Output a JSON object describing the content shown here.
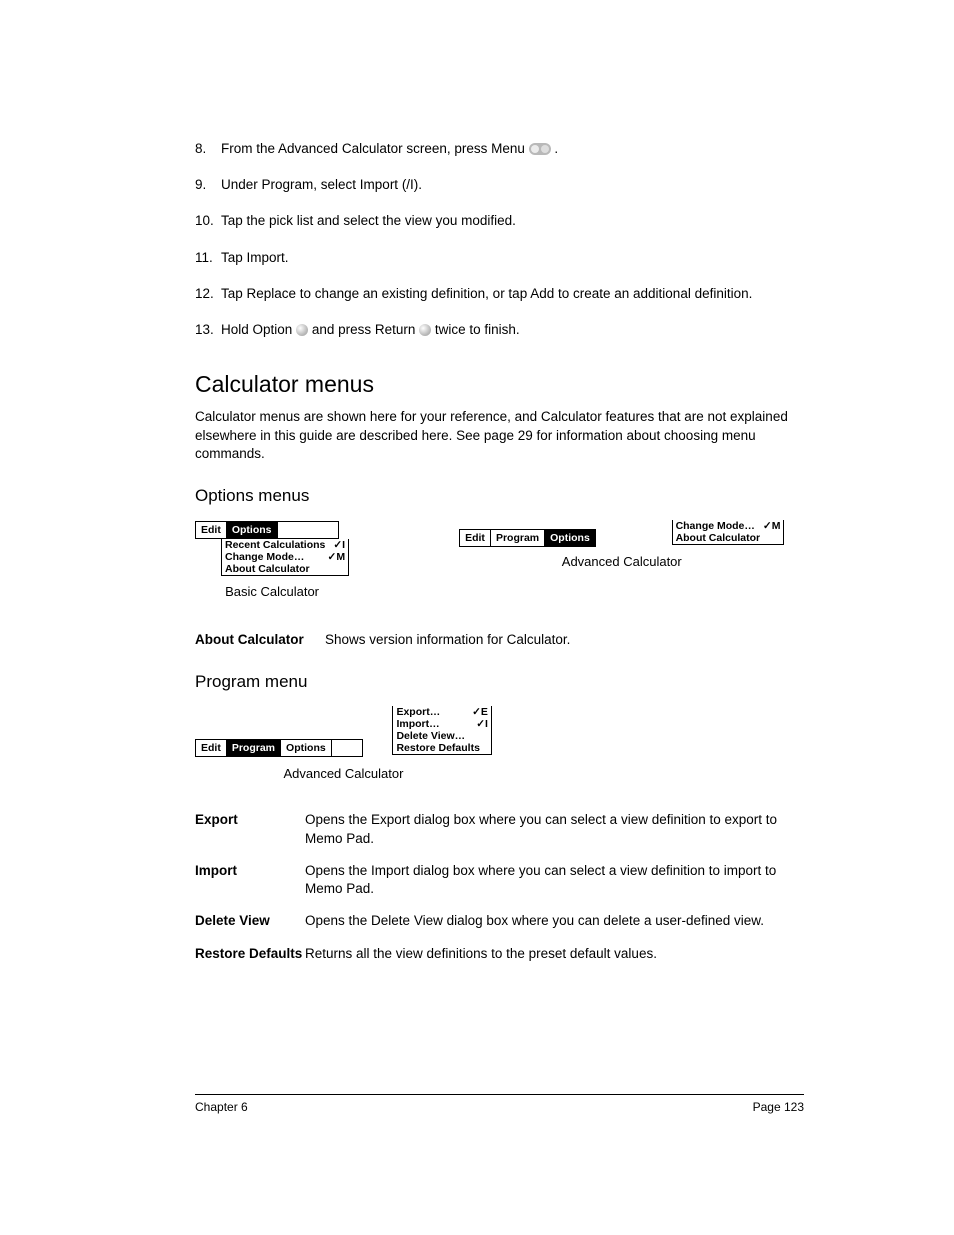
{
  "steps": [
    {
      "num": "8.",
      "pre": "From the Advanced Calculator screen, press Menu ",
      "icon": "pill",
      "post": "."
    },
    {
      "num": "9.",
      "text": "Under Program, select Import (/I)."
    },
    {
      "num": "10.",
      "text": "Tap the pick list and select the view you modified."
    },
    {
      "num": "11.",
      "text": "Tap Import."
    },
    {
      "num": "12.",
      "text": "Tap Replace to change an existing definition, or tap Add to create an additional definition."
    },
    {
      "num": "13.",
      "pre": "Hold Option ",
      "icon": "knob",
      "mid": " and press Return ",
      "icon2": "knob",
      "post": " twice to finish."
    }
  ],
  "section_title": "Calculator menus",
  "section_intro": "Calculator menus are shown here for your reference, and Calculator features that are not explained elsewhere in this guide are described here. See page 29 for information about choosing menu commands.",
  "options_heading": "Options menus",
  "basic_menu": {
    "tabs": [
      "Edit",
      "Options"
    ],
    "active": 1,
    "items": [
      {
        "label": "Recent Calculations",
        "shortcut": "✓I"
      },
      {
        "label": "Change Mode…",
        "shortcut": "✓M"
      },
      {
        "label": "About Calculator",
        "shortcut": ""
      }
    ],
    "caption": "Basic Calculator"
  },
  "advanced_menu": {
    "tabs": [
      "Edit",
      "Program",
      "Options"
    ],
    "active": 2,
    "items": [
      {
        "label": "Change Mode…",
        "shortcut": "✓M"
      },
      {
        "label": "About Calculator",
        "shortcut": ""
      }
    ],
    "caption": "Advanced Calculator"
  },
  "about_row": {
    "term": "About Calculator",
    "desc": "Shows version information for Calculator."
  },
  "program_heading": "Program menu",
  "program_menu": {
    "tabs": [
      "Edit",
      "Program",
      "Options"
    ],
    "active": 1,
    "items": [
      {
        "label": "Export…",
        "shortcut": "✓E"
      },
      {
        "label": "Import…",
        "shortcut": "✓I"
      },
      {
        "label": "Delete View…",
        "shortcut": ""
      },
      {
        "label": "Restore Defaults",
        "shortcut": ""
      }
    ],
    "caption": "Advanced Calculator"
  },
  "program_defs": [
    {
      "term": "Export",
      "desc": "Opens the Export dialog box where you can select a view definition to export to Memo Pad."
    },
    {
      "term": "Import",
      "desc": "Opens the Import dialog box where you can select a view definition to import to Memo Pad."
    },
    {
      "term": "Delete View",
      "desc": "Opens the Delete View dialog box where you can delete a user-defined view."
    },
    {
      "term": "Restore Defaults",
      "desc": "Returns all the view definitions to the preset default values."
    }
  ],
  "footer": {
    "left": "Chapter 6",
    "right": "Page 123"
  }
}
